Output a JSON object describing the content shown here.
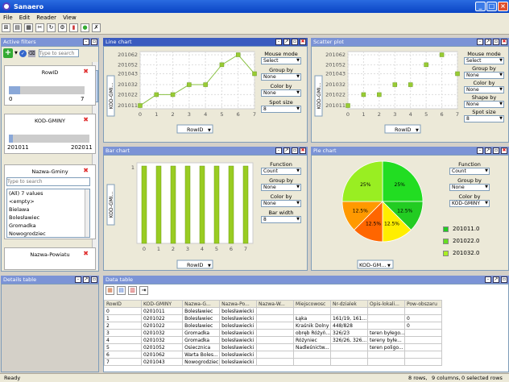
{
  "app": {
    "title": "Sanaero",
    "menu": [
      "File",
      "Edit",
      "Reader",
      "View"
    ]
  },
  "filters": {
    "header": "Active filters",
    "search_placeholder": "Type to search",
    "rowid": {
      "title": "RowID",
      "min": "0",
      "max": "7",
      "fill": 0.15
    },
    "kod": {
      "title": "KOD-GMINY",
      "min": "201011",
      "max": "202011",
      "fill": 0.05
    },
    "gminy": {
      "title": "Nazwa-Gminy",
      "placeholder": "Type to search",
      "items": [
        "(All) 7 values",
        "<empty>",
        "Bielawa",
        "Bolesławiec",
        "Gromadka",
        "Nowogrodziec"
      ]
    },
    "powiatu": {
      "title": "Nazwa-Powiatu"
    }
  },
  "details": {
    "header": "Details table"
  },
  "line_chart": {
    "header": "Line chart",
    "ylabel": "KOD-GMI...",
    "xaxis_sel": "RowID",
    "controls": [
      {
        "label": "Mouse mode",
        "value": "Select"
      },
      {
        "label": "Group by",
        "value": "None"
      },
      {
        "label": "Color by",
        "value": "None"
      },
      {
        "label": "Spot size",
        "value": "8"
      }
    ]
  },
  "scatter": {
    "header": "Scatter plot",
    "ylabel": "KOD-GMI...",
    "xaxis_sel": "RowID",
    "controls": [
      {
        "label": "Mouse mode",
        "value": "Select"
      },
      {
        "label": "Group by",
        "value": "None"
      },
      {
        "label": "Color by",
        "value": "None"
      },
      {
        "label": "Shape by",
        "value": "None"
      },
      {
        "label": "Spot size",
        "value": "8"
      }
    ]
  },
  "bar": {
    "header": "Bar chart",
    "ylabel": "KOD-GMI...",
    "xaxis_sel": "RowID",
    "controls": [
      {
        "label": "Function",
        "value": "Count"
      },
      {
        "label": "Group by",
        "value": "None"
      },
      {
        "label": "Color by",
        "value": "None"
      },
      {
        "label": "Bar width",
        "value": "8"
      }
    ]
  },
  "pie": {
    "header": "Pie chart",
    "xaxis_sel": "KOD-GM...",
    "controls": [
      {
        "label": "Function",
        "value": "Count"
      },
      {
        "label": "Group by",
        "value": "None"
      },
      {
        "label": "Color by",
        "value": "KOD-GMINY"
      }
    ],
    "legend": [
      {
        "label": "201011.0",
        "color": "#22cc22"
      },
      {
        "label": "201022.0",
        "color": "#66dd22"
      },
      {
        "label": "201032.0",
        "color": "#aaee22"
      }
    ]
  },
  "chart_data": [
    {
      "type": "line",
      "x": [
        0,
        1,
        2,
        3,
        4,
        5,
        6,
        7
      ],
      "y": [
        201011,
        201022,
        201022,
        201032,
        201032,
        201052,
        201062,
        201043
      ],
      "xlim": [
        0,
        7
      ],
      "ylim": [
        201011,
        201062
      ],
      "yticks": [
        "201062",
        "201052",
        "201043",
        "201032",
        "201022",
        "201011"
      ],
      "xticks": [
        "0",
        "1",
        "2",
        "3",
        "4",
        "5",
        "6",
        "7"
      ]
    },
    {
      "type": "scatter",
      "x": [
        0,
        1,
        2,
        3,
        4,
        5,
        6,
        7
      ],
      "y": [
        201011,
        201022,
        201022,
        201032,
        201032,
        201052,
        201062,
        201043
      ],
      "xlim": [
        0,
        7
      ],
      "ylim": [
        201011,
        201062
      ],
      "yticks": [
        "201062",
        "201052",
        "201043",
        "201032",
        "201022",
        "201011"
      ],
      "xticks": [
        "0",
        "1",
        "2",
        "3",
        "4",
        "5",
        "6",
        "7"
      ]
    },
    {
      "type": "bar",
      "categories": [
        "0",
        "1",
        "2",
        "3",
        "4",
        "5",
        "6",
        "7"
      ],
      "values": [
        1,
        1,
        1,
        1,
        1,
        1,
        1,
        1
      ],
      "ylim": [
        0,
        1
      ],
      "yticks": [
        "1"
      ]
    },
    {
      "type": "pie",
      "labels": [
        "25%",
        "12.5%",
        "12.5%",
        "12.5%",
        "12.5%",
        "25%"
      ],
      "values": [
        25,
        12.5,
        12.5,
        12.5,
        12.5,
        25
      ],
      "colors": [
        "#22dd22",
        "#22cc22",
        "#ffee00",
        "#ff6600",
        "#ff9900",
        "#99ee22"
      ]
    }
  ],
  "table": {
    "header": "Data table",
    "columns": [
      "RowID",
      "KOD-GMINY",
      "Nazwa-G...",
      "Nazwa-Po...",
      "Nazwa-W...",
      "Miejscowosc",
      "Nr-dzialek",
      "Opis-lokali...",
      "Pow-obszaru"
    ],
    "rows": [
      [
        "0",
        "0201011",
        "Bolesławiec",
        "bolesławiecki",
        "",
        "",
        "",
        "",
        ""
      ],
      [
        "1",
        "0201022",
        "Bolesławiec",
        "bolesławiecki",
        "",
        "Łąka",
        "161/19, 161...",
        "",
        "0"
      ],
      [
        "2",
        "0201022",
        "Bolesławiec",
        "bolesławiecki",
        "",
        "Kraśnik Dolny",
        "448/828",
        "",
        "0"
      ],
      [
        "3",
        "0201032",
        "Gromadka",
        "bolesławiecki",
        "",
        "obręb Różyń...",
        "326/23",
        "teren byłego...",
        ""
      ],
      [
        "4",
        "0201032",
        "Gromadka",
        "bolesławiecki",
        "",
        "Różyniec",
        "326/26, 326...",
        "tereny byłe...",
        ""
      ],
      [
        "5",
        "0201052",
        "Osiecznica",
        "bolesławiecki",
        "",
        "Nadleśnictw...",
        "",
        "teren poligo...",
        ""
      ],
      [
        "6",
        "0201062",
        "Warta Boles...",
        "bolesławiecki",
        "",
        "",
        "",
        "",
        ""
      ],
      [
        "7",
        "0201043",
        "Nowogrodziec",
        "bolesławiecki",
        "",
        "",
        "",
        "",
        ""
      ]
    ]
  },
  "status": {
    "left": "Ready",
    "rows": "8 rows,",
    "cols": "9 columns,",
    "sel": "0 selected rows"
  }
}
